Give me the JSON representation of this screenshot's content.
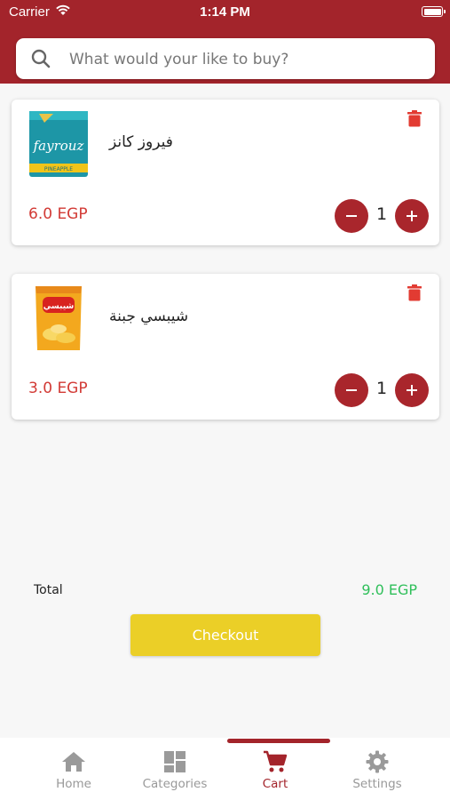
{
  "status_bar": {
    "carrier": "Carrier",
    "time": "1:14 PM"
  },
  "search": {
    "placeholder": "What would your like to buy?"
  },
  "cart": {
    "items": [
      {
        "name": "فيروز كانز",
        "price": "6.0 EGP",
        "quantity": "1",
        "image": "fayrouz-can",
        "image_text": "fayrouz",
        "image_subtext": "PINEAPPLE"
      },
      {
        "name": "شيبسي جبنة",
        "price": "3.0 EGP",
        "quantity": "1",
        "image": "chipsy-bag",
        "image_text": "شيبسي"
      }
    ],
    "total_label": "Total",
    "total_value": "9.0 EGP",
    "checkout_label": "Checkout"
  },
  "tabs": [
    {
      "label": "Home",
      "icon": "home-icon"
    },
    {
      "label": "Categories",
      "icon": "grid-icon"
    },
    {
      "label": "Cart",
      "icon": "cart-icon",
      "active": true
    },
    {
      "label": "Settings",
      "icon": "gear-icon"
    }
  ],
  "colors": {
    "brand": "#a3242b",
    "price": "#d23a35",
    "total": "#2fbf5a",
    "checkout": "#ebcf27"
  }
}
